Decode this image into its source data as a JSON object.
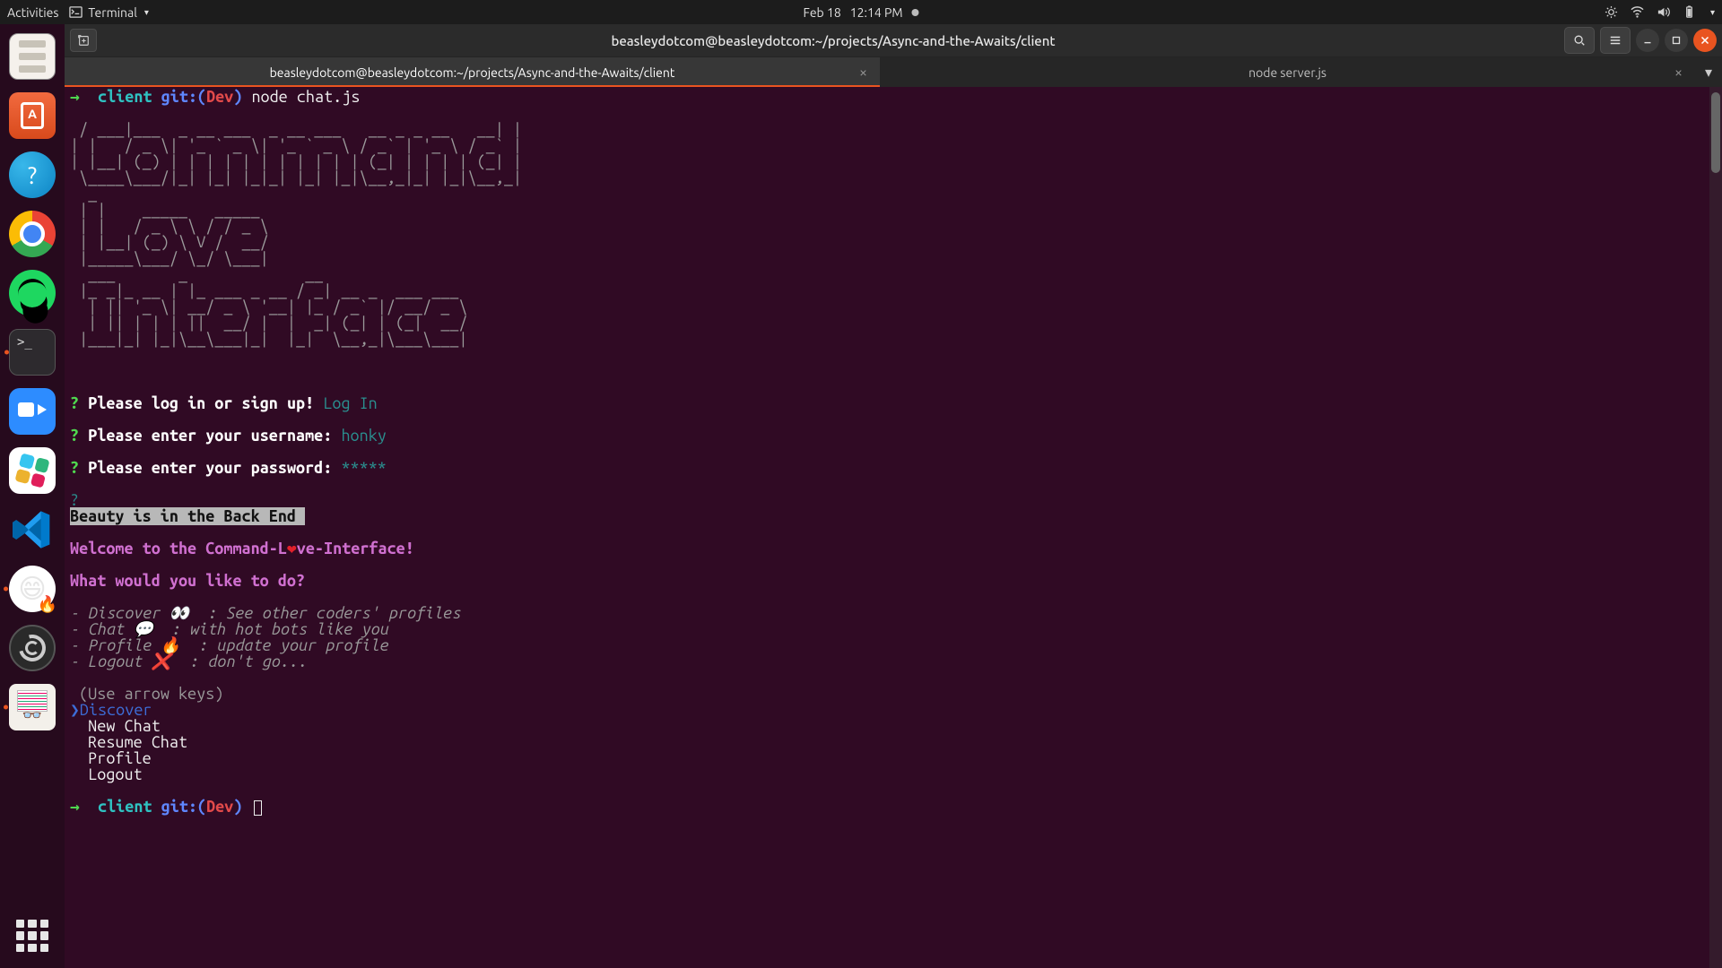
{
  "topbar": {
    "activities": "Activities",
    "app_menu": "Terminal",
    "date": "Feb 18",
    "time": "12:14 PM"
  },
  "window": {
    "title": "beasleydotcom@beasleydotcom:~/projects/Async-and-the-Awaits/client"
  },
  "tabs": {
    "active": "beasleydotcom@beasleydotcom:~/projects/Async-and-the-Awaits/client",
    "inactive": "node server.js"
  },
  "prompt": {
    "arrow": "→",
    "dir": "client",
    "git": "git:(",
    "branch": "Dev",
    "close": ")",
    "command": "node chat.js"
  },
  "ascii": " / ___|___  _ __ ___  _ __ ___   __ _ _ __   __| |\n| |   / _ \\| '_ ` _ \\| '_ ` _ \\ / _` | '_ \\ / _` |\n| |__| (_) | | | | | | | | | | | (_| | | | | (_| |\n \\____\\___/|_| |_| |_|_| |_| |_|\\__,_|_| |_|\\__,_|\n  _\n | |    _____   _____\n | |   / _ \\ \\ / / _ \\\n | |__| (_) \\ V /  __/\n |_____\\___/ \\_/ \\___|\n  ___       _             __\n |_ _|_ __ | |_ ___ _ __ / _| __ _  ___ ___\n  | || '_ \\| __/ _ \\ '__| |_ / _` |/ __/ _ \\\n  | || | | | ||  __/ |  |  _| (_| | (_|  __/\n |___|_| |_|\\__\\___|_|  |_|  \\__,_|\\___\\___|",
  "login": {
    "q": "?",
    "signin_prompt": "Please log in or sign up!",
    "signin_choice": "Log In",
    "user_prompt": "Please enter your username:",
    "user_value": "honky",
    "pass_prompt": "Please enter your password:",
    "pass_value": "*****"
  },
  "tagline": "Beauty is in the Back End ",
  "welcome": {
    "pre": "Welcome to the Command-L",
    "heart": "❤",
    "post": "ve-Interface!"
  },
  "question": "What would you like to do?",
  "help": {
    "discover": "- Discover 👀  : See other coders' profiles",
    "chat": "- Chat 💬  : with hot bots like you",
    "profile": "- Profile 🔥  : update your profile",
    "logout": "- Logout ❌  : don't go..."
  },
  "menu": {
    "hint": "(Use arrow keys)",
    "pointer": "❯",
    "options": [
      "Discover",
      "New Chat",
      "Resume Chat",
      "Profile",
      "Logout"
    ]
  }
}
